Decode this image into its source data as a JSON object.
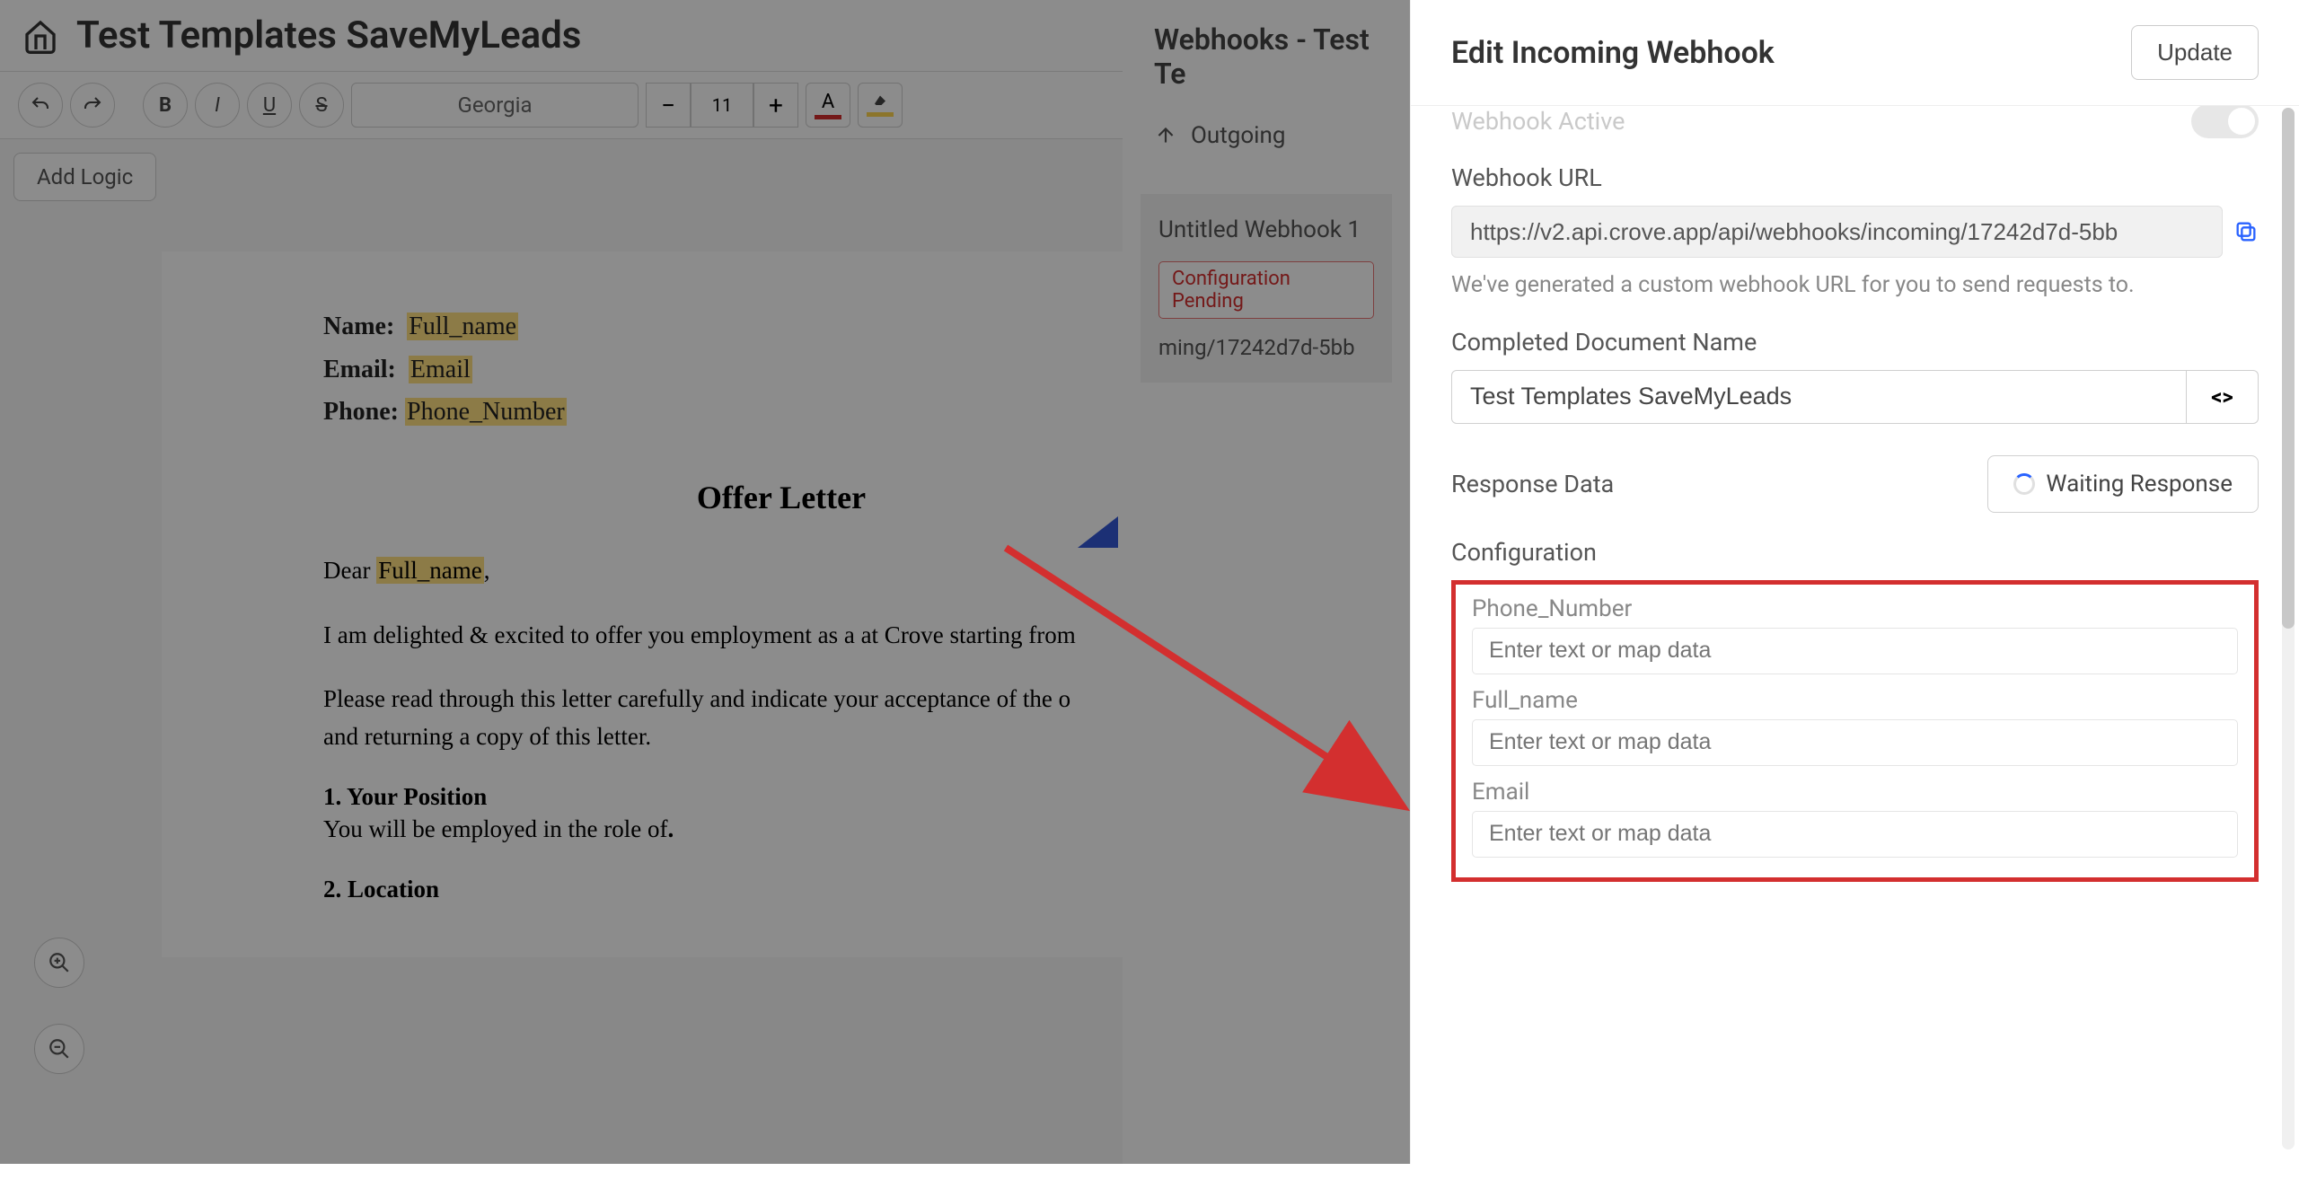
{
  "header": {
    "title": "Test Templates SaveMyLeads"
  },
  "toolbar": {
    "font": "Georgia",
    "size": "11",
    "add_logic": "Add Logic"
  },
  "document": {
    "fields": {
      "name_label": "Name:",
      "name_value": "Full_name",
      "email_label": "Email:",
      "email_value": "Email",
      "phone_label": "Phone:",
      "phone_value": "Phone_Number"
    },
    "title": "Offer Letter",
    "greeting_prefix": "Dear ",
    "greeting_var": "Full_name",
    "greeting_suffix": ",",
    "p1": "I am delighted & excited to offer you employment as a at Crove starting from",
    "p2": "Please read through this letter carefully and indicate your acceptance of the o",
    "p2b": "and returning a copy of this letter.",
    "h1": "1. Your Position",
    "h1_text": "You will be employed in the role of",
    "h2": "2. Location"
  },
  "mid": {
    "title": "Webhooks - Test Te",
    "tab": "Outgoing",
    "webhook_name": "Untitled Webhook 1",
    "badge": "Configuration Pending",
    "url_fragment": "ming/17242d7d-5bb"
  },
  "drawer": {
    "title": "Edit Incoming Webhook",
    "update": "Update",
    "active_label": "Webhook Active",
    "url_label": "Webhook URL",
    "url_value": "https://v2.api.crove.app/api/webhooks/incoming/17242d7d-5bb",
    "url_helper": "We've generated a custom webhook URL for you to send requests to.",
    "docname_label": "Completed Document Name",
    "docname_value": "Test Templates SaveMyLeads",
    "response_label": "Response Data",
    "waiting": "Waiting Response",
    "config_label": "Configuration",
    "fields": [
      {
        "label": "Phone_Number",
        "placeholder": "Enter text or map data"
      },
      {
        "label": "Full_name",
        "placeholder": "Enter text or map data"
      },
      {
        "label": "Email",
        "placeholder": "Enter text or map data"
      }
    ]
  }
}
